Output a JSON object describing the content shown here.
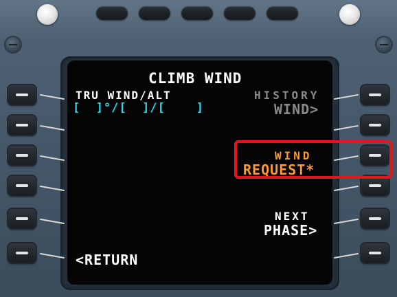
{
  "screen": {
    "title": "CLIMB WIND",
    "left": {
      "label_1": "TRU WIND/ALT",
      "field_1": "[  ]°/[  ]/[    ]",
      "return": "<RETURN"
    },
    "right": {
      "history_label": "HISTORY",
      "history_value": "WIND>",
      "wind_request_label": "WIND",
      "wind_request_value": "REQUEST*",
      "next_phase_label": "NEXT",
      "next_phase_value": "PHASE>"
    }
  },
  "colors": {
    "white": "#ffffff",
    "cyan": "#2fd8f0",
    "grey": "#8a8a8a",
    "amber": "#ff9a2e",
    "highlight": "#e8141b"
  }
}
